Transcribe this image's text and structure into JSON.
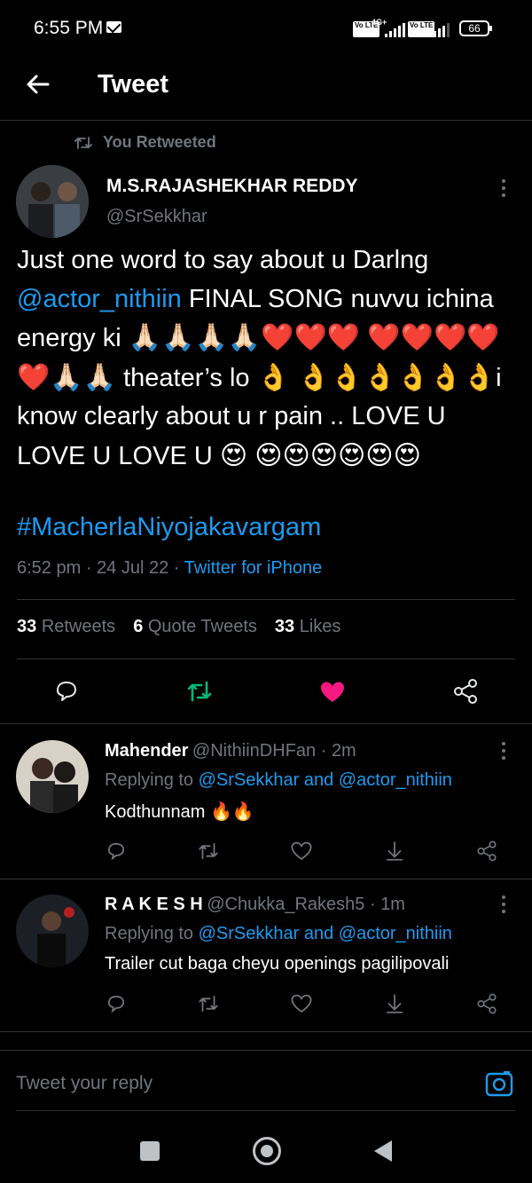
{
  "status_bar": {
    "time": "6:55 PM",
    "network_label": "4G+",
    "sim1_badge": "Vo LTE",
    "sim2_badge": "Vo LTE",
    "battery": "66"
  },
  "header": {
    "title": "Tweet"
  },
  "main_tweet": {
    "retweeted_label": "You Retweeted",
    "author_name": "M.S.RAJASHEKHAR REDDY",
    "author_handle": "@SrSekkhar",
    "text_part1": "Just one word to say about u Darlng ",
    "mention": "@actor_nithiin",
    "text_part2": " FINAL SONG nuvvu ichina energy ki ",
    "emoji_line1": "🙏🏻🙏🏻🙏🏻🙏🏻❤️❤️❤️",
    "emoji_line2": "❤️❤️❤️❤️❤️🙏🏻🙏🏻",
    "text_part3": " theater’s lo ",
    "emoji_ok1": "👌",
    "emoji_ok2": "👌👌👌👌👌👌",
    "text_part4": "i know clearly about u r pain .. LOVE U LOVE U LOVE U ",
    "emoji_love": "😍",
    "emoji_love_row": "😍😍😍😍😍😍",
    "hashtag": "#MacherlaNiyojakavargam",
    "time": "6:52 pm",
    "date": "24 Jul 22",
    "source": "Twitter for iPhone",
    "retweets_count": "33",
    "retweets_label": "Retweets",
    "quotes_count": "6",
    "quotes_label": "Quote Tweets",
    "likes_count": "33",
    "likes_label": "Likes",
    "dot_sep": " · "
  },
  "replies": [
    {
      "name": "Mahender",
      "handle": "@NithiinDHFan",
      "age": "2m",
      "replying_prefix": "Replying to ",
      "replying_to": "@SrSekkhar and @actor_nithiin",
      "text": "Kodthunnam",
      "emoji": "🔥🔥"
    },
    {
      "name": "R A K E S H",
      "handle": "@Chukka_Rakesh5",
      "age": "1m",
      "replying_prefix": "Replying to ",
      "replying_to": "@SrSekkhar and @actor_nithiin",
      "text": "Trailer cut baga cheyu openings pagilipovali"
    }
  ],
  "reply_bar": {
    "placeholder": "Tweet your reply"
  },
  "colors": {
    "accent": "#1d9bf0",
    "like": "#f91880",
    "retweet": "#00ba7c",
    "muted": "#71767b"
  },
  "icons": [
    "back-arrow-icon",
    "retweet-icon",
    "more-icon",
    "reply-icon",
    "like-icon",
    "share-icon",
    "camera-icon",
    "nav-square-icon",
    "nav-circle-icon",
    "nav-back-icon"
  ]
}
